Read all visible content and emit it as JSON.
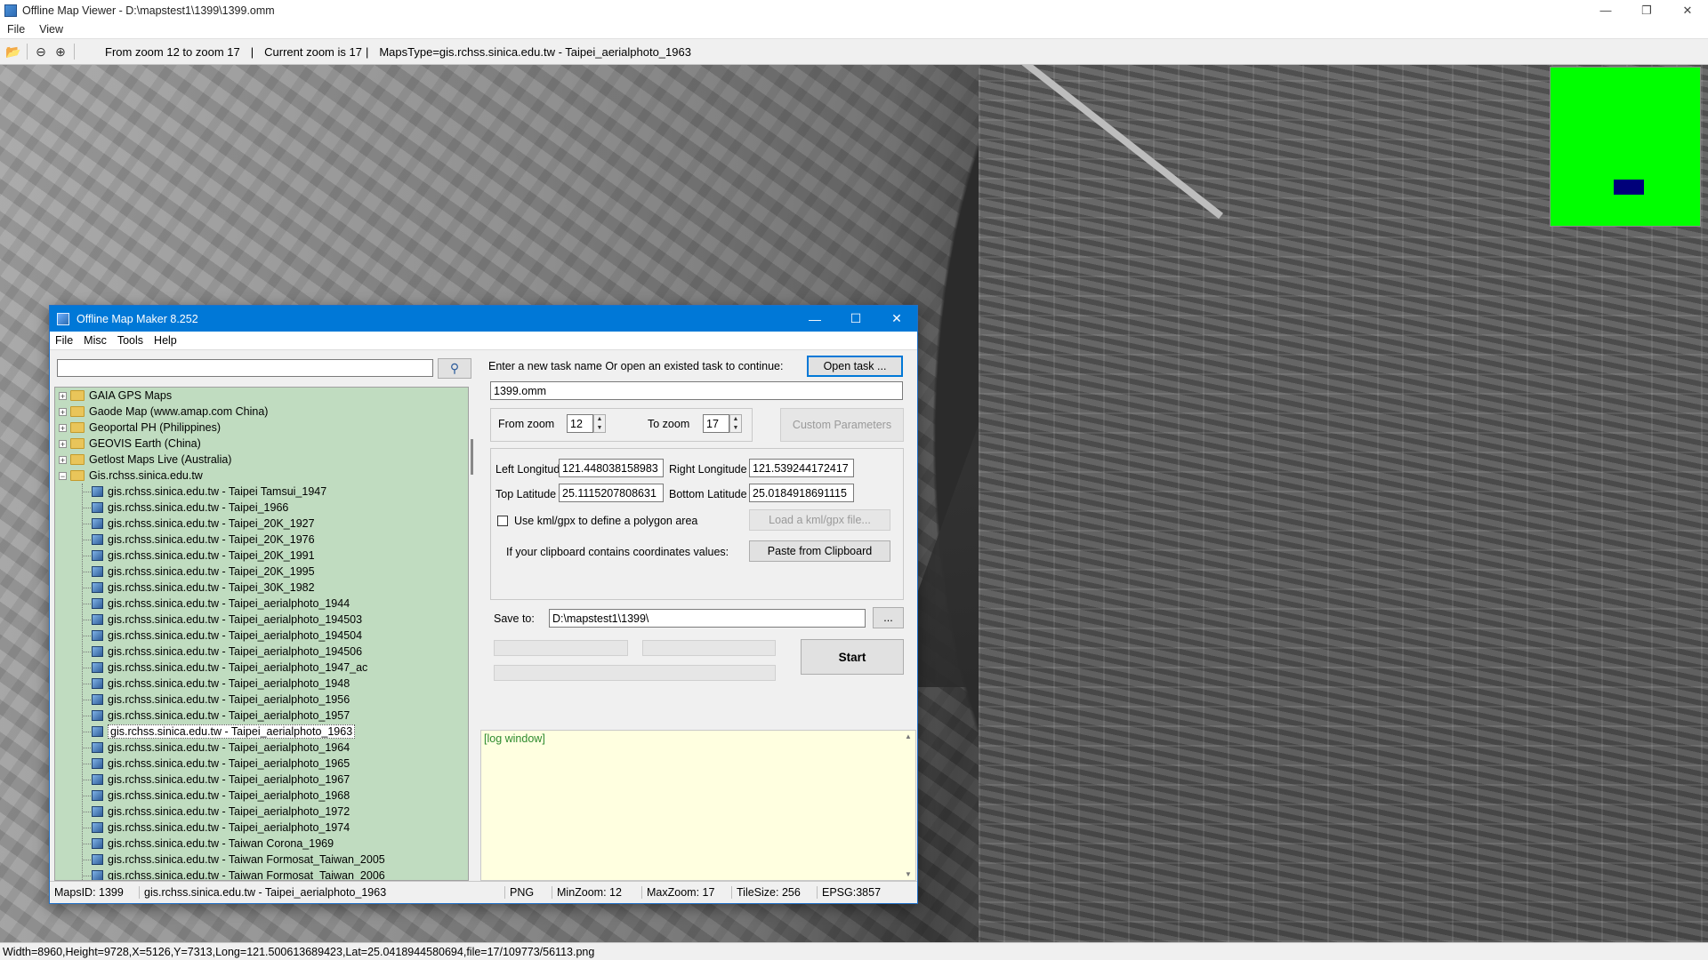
{
  "window": {
    "title": "Offline Map Viewer - D:\\mapstest1\\1399\\1399.omm",
    "menu": [
      "File",
      "View"
    ]
  },
  "toolbar": {
    "zoom_range": "From zoom 12 to zoom 17",
    "current_zoom": "Current zoom is 17",
    "maps_type": "MapsType=gis.rchss.sinica.edu.tw - Taipei_aerialphoto_1963",
    "sep": "|"
  },
  "statusbar": {
    "text": "Width=8960,Height=9728,X=5126,Y=7313,Long=121.500613689423,Lat=25.0418944580694,file=17/109773/56113.png"
  },
  "dialog": {
    "title": "Offline Map Maker 8.252",
    "menu": [
      "File",
      "Misc",
      "Tools",
      "Help"
    ],
    "search": {
      "value": "",
      "placeholder": ""
    },
    "tree": {
      "folders_top": [
        "GAIA GPS Maps",
        "Gaode Map (www.amap.com China)",
        "Geoportal PH (Philippines)",
        "GEOVIS Earth (China)",
        "Getlost Maps Live (Australia)"
      ],
      "open_folder": "Gis.rchss.sinica.edu.tw",
      "items": [
        "gis.rchss.sinica.edu.tw - Taipei Tamsui_1947",
        "gis.rchss.sinica.edu.tw - Taipei_1966",
        "gis.rchss.sinica.edu.tw - Taipei_20K_1927",
        "gis.rchss.sinica.edu.tw - Taipei_20K_1976",
        "gis.rchss.sinica.edu.tw - Taipei_20K_1991",
        "gis.rchss.sinica.edu.tw - Taipei_20K_1995",
        "gis.rchss.sinica.edu.tw - Taipei_30K_1982",
        "gis.rchss.sinica.edu.tw - Taipei_aerialphoto_1944",
        "gis.rchss.sinica.edu.tw - Taipei_aerialphoto_194503",
        "gis.rchss.sinica.edu.tw - Taipei_aerialphoto_194504",
        "gis.rchss.sinica.edu.tw - Taipei_aerialphoto_194506",
        "gis.rchss.sinica.edu.tw - Taipei_aerialphoto_1947_ac",
        "gis.rchss.sinica.edu.tw - Taipei_aerialphoto_1948",
        "gis.rchss.sinica.edu.tw - Taipei_aerialphoto_1956",
        "gis.rchss.sinica.edu.tw - Taipei_aerialphoto_1957",
        "gis.rchss.sinica.edu.tw - Taipei_aerialphoto_1963",
        "gis.rchss.sinica.edu.tw - Taipei_aerialphoto_1964",
        "gis.rchss.sinica.edu.tw - Taipei_aerialphoto_1965",
        "gis.rchss.sinica.edu.tw - Taipei_aerialphoto_1967",
        "gis.rchss.sinica.edu.tw - Taipei_aerialphoto_1968",
        "gis.rchss.sinica.edu.tw - Taipei_aerialphoto_1972",
        "gis.rchss.sinica.edu.tw - Taipei_aerialphoto_1974",
        "gis.rchss.sinica.edu.tw - Taiwan Corona_1969",
        "gis.rchss.sinica.edu.tw - Taiwan Formosat_Taiwan_2005",
        "gis.rchss.sinica.edu.tw - Taiwan Formosat_Taiwan_2006"
      ],
      "selected_index": 15
    },
    "task_prompt": "Enter a new task name Or open an existed task to continue:",
    "open_task_label": "Open task ...",
    "task_name": "1399.omm",
    "from_zoom_label": "From zoom",
    "from_zoom": "12",
    "to_zoom_label": "To zoom",
    "to_zoom": "17",
    "custom_params_label": "Custom Parameters",
    "left_lon_label": "Left Longitude",
    "left_lon": "121.448038158983",
    "right_lon_label": "Right Longitude",
    "right_lon": "121.539244172417",
    "top_lat_label": "Top Latitude",
    "top_lat": "25.1115207808631",
    "bottom_lat_label": "Bottom Latitude",
    "bottom_lat": "25.0184918691115",
    "kml_checkbox_label": "Use kml/gpx to define a polygon area",
    "kml_checked": false,
    "load_kml_label": "Load a kml/gpx file...",
    "clipboard_prompt": "If your clipboard contains coordinates values:",
    "paste_label": "Paste from Clipboard",
    "save_to_label": "Save to:",
    "save_path": "D:\\mapstest1\\1399\\",
    "browse_label": "...",
    "start_label": "Start",
    "log_text": "[log window]",
    "status": {
      "maps_id": "MapsID: 1399",
      "map_name": "gis.rchss.sinica.edu.tw - Taipei_aerialphoto_1963",
      "format": "PNG",
      "min_zoom": "MinZoom: 12",
      "max_zoom": "MaxZoom: 17",
      "tile_size": "TileSize: 256",
      "epsg": "EPSG:3857"
    }
  },
  "colors": {
    "titlebar_accent": "#0078d7",
    "tree_background": "#c0dcc0",
    "log_background": "#ffffe0",
    "minimap_background": "#00ff00",
    "minimap_viewport": "#00007a"
  }
}
